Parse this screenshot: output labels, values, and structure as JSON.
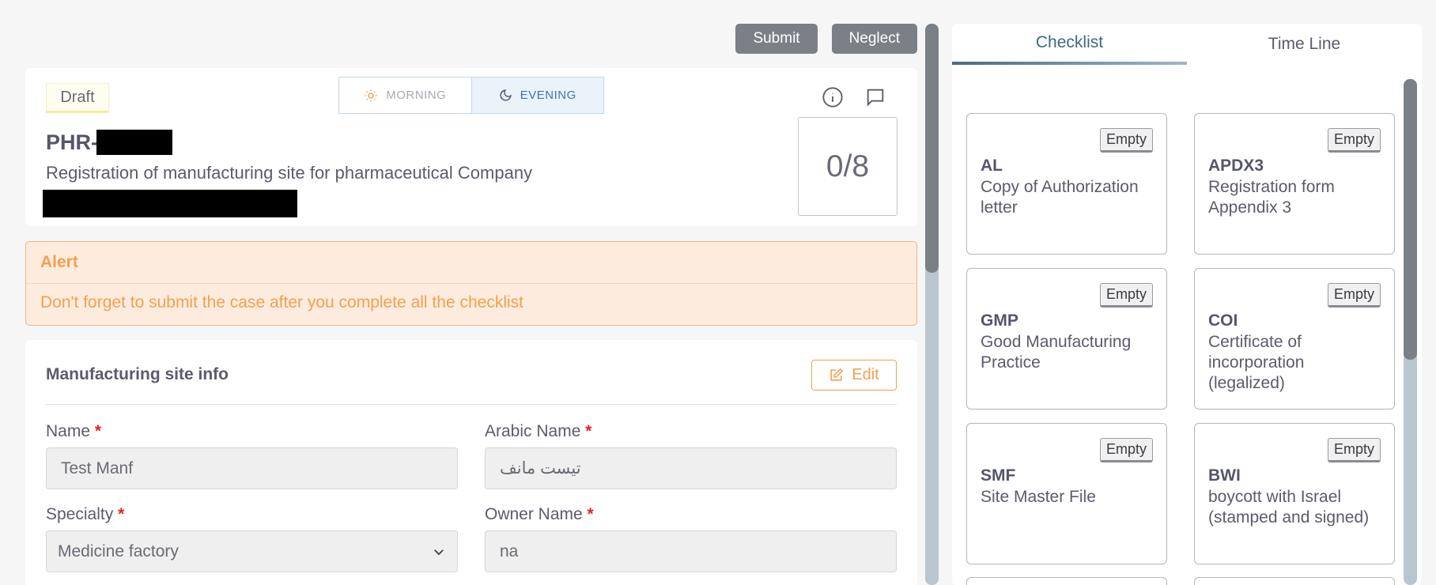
{
  "actions": {
    "submit_label": "Submit",
    "neglect_label": "Neglect"
  },
  "case": {
    "status": "Draft",
    "shift": {
      "morning_label": "MORNING",
      "evening_label": "EVENING",
      "selected": "EVENING"
    },
    "id_prefix": "PHR-",
    "subject": "Registration of manufacturing site for pharmaceutical Company",
    "progress": "0/8"
  },
  "alert": {
    "title": "Alert",
    "message": "Don't forget to submit the case after you complete all the checklist"
  },
  "site_info": {
    "title": "Manufacturing site info",
    "edit_label": "Edit",
    "fields": {
      "name": {
        "label": "Name",
        "value": "Test Manf"
      },
      "arabic_name": {
        "label": "Arabic Name",
        "value": "تيست مانف"
      },
      "specialty": {
        "label": "Specialty",
        "value": "Medicine factory"
      },
      "owner_name": {
        "label": "Owner Name",
        "value": "na"
      }
    },
    "required_mark": "*"
  },
  "side_panel": {
    "tabs": [
      {
        "label": "Checklist",
        "active": true
      },
      {
        "label": "Time Line",
        "active": false
      }
    ],
    "checklist": [
      {
        "status": "Empty",
        "code": "AL",
        "description": "Copy of Authorization letter"
      },
      {
        "status": "Empty",
        "code": "APDX3",
        "description": "Registration form Appendix 3"
      },
      {
        "status": "Empty",
        "code": "GMP",
        "description": "Good Manufacturing Practice"
      },
      {
        "status": "Empty",
        "code": "COI",
        "description": "Certificate of incorporation (legalized)"
      },
      {
        "status": "Empty",
        "code": "SMF",
        "description": "Site Master File"
      },
      {
        "status": "Empty",
        "code": "BWI",
        "description": "boycott with Israel (stamped and signed)"
      }
    ]
  },
  "colors": {
    "accent_orange": "#f3a04f",
    "evening_blue": "#3e78a8",
    "button_grey": "#7b8087",
    "tab_active": "#3d6a80",
    "required_red": "#e02424"
  },
  "icons": {
    "morning": "sun-icon",
    "evening": "moon-icon",
    "info": "info-icon",
    "comment": "comment-icon",
    "edit": "edit-icon",
    "select": "chevron-down-icon"
  }
}
